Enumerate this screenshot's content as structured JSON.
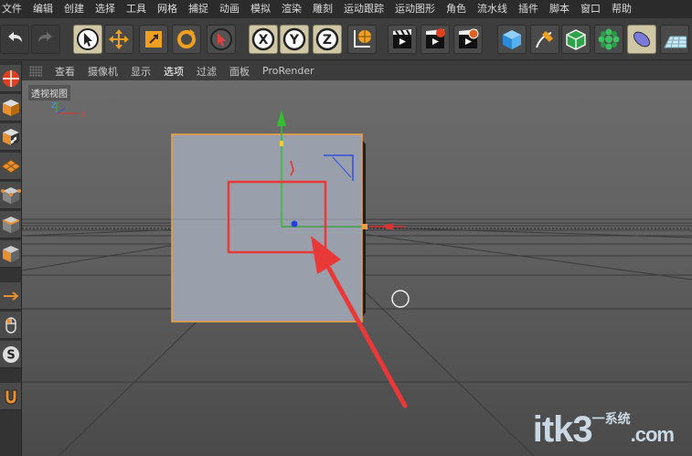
{
  "menu": [
    "文件",
    "编辑",
    "创建",
    "选择",
    "工具",
    "网格",
    "捕捉",
    "动画",
    "模拟",
    "渲染",
    "雕刻",
    "运动跟踪",
    "运动图形",
    "角色",
    "流水线",
    "插件",
    "脚本",
    "窗口",
    "帮助"
  ],
  "toolbar": {
    "icons": [
      "undo-icon",
      "redo-icon",
      "select-cursor-icon",
      "move-icon",
      "scale-icon",
      "rotate-icon",
      "live-selection-icon",
      "x-axis-icon",
      "y-axis-icon",
      "z-axis-icon",
      "world-coordinate-icon",
      "render-view-icon",
      "render-picture-viewer-icon",
      "render-settings-icon",
      "cube-icon",
      "pen-icon",
      "subdivision-icon",
      "cloner-icon",
      "deformer-icon",
      "floor-icon"
    ],
    "axis_labels": [
      "X",
      "Y",
      "Z"
    ]
  },
  "viewport_menu": [
    "查看",
    "摄像机",
    "显示",
    "选项",
    "过滤",
    "面板",
    "ProRender"
  ],
  "viewport": {
    "label": "透视视图",
    "axis_labels": {
      "y": "Y",
      "z": "Z",
      "x": "X"
    }
  },
  "watermark": {
    "main": "itk3",
    "sub": "一系统",
    "suffix": ".com"
  },
  "colors": {
    "accent_orange": "#f0a040",
    "axis_red": "#e03030",
    "axis_green": "#30c030",
    "axis_blue": "#3050e0",
    "annotation_red": "#e83838"
  }
}
